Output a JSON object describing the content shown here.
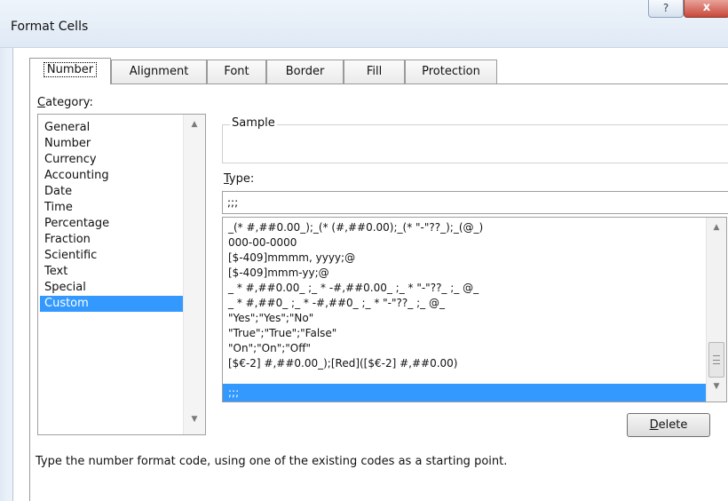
{
  "window": {
    "title": "Format Cells",
    "help_glyph": "?",
    "close_glyph": "x"
  },
  "tabs": [
    {
      "label": "Number",
      "active": true
    },
    {
      "label": "Alignment"
    },
    {
      "label": "Font"
    },
    {
      "label": "Border"
    },
    {
      "label": "Fill"
    },
    {
      "label": "Protection"
    }
  ],
  "category": {
    "label_hotkey": "C",
    "label_rest": "ategory:",
    "items": [
      "General",
      "Number",
      "Currency",
      "Accounting",
      "Date",
      "Time",
      "Percentage",
      "Fraction",
      "Scientific",
      "Text",
      "Special",
      "Custom"
    ],
    "selected": "Custom"
  },
  "sample": {
    "label": "Sample",
    "value": ""
  },
  "type": {
    "label_hotkey": "T",
    "label_rest": "ype:",
    "value": ";;;",
    "formats": [
      "_(* #,##0.00_);_(* (#,##0.00);_(* \"-\"??_);_(@_)",
      "000-00-0000",
      "[$-409]mmmm, yyyy;@",
      "[$-409]mmm-yy;@",
      "_ * #,##0.00_ ;_ * -#,##0.00_ ;_ * \"-\"??_ ;_ @_",
      "_ * #,##0_ ;_ * -#,##0_ ;_ * \"-\"??_ ;_ @_",
      "\"Yes\";\"Yes\";\"No\"",
      "\"True\";\"True\";\"False\"",
      "\"On\";\"On\";\"Off\"",
      "[$€-2] #,##0.00_);[Red]([$€-2] #,##0.00)",
      ";;;"
    ],
    "selected": ";;;"
  },
  "delete_button": {
    "hotkey": "D",
    "rest": "elete"
  },
  "hint": "Type the number format code, using one of the existing codes as a starting point.",
  "colors": {
    "selection": "#3399ff",
    "close_button": "#c9483a"
  },
  "icons": {
    "up_arrow": "▲",
    "down_arrow": "▼"
  }
}
